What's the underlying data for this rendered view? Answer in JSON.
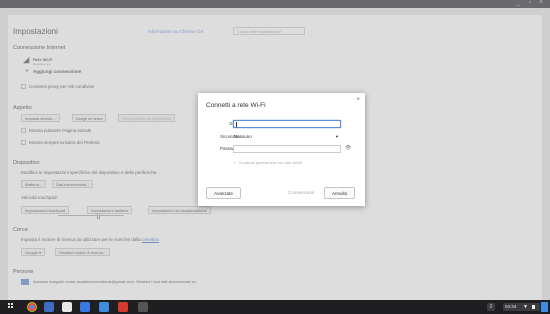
{
  "header": {
    "title": "Impostazioni",
    "about_link": "Informazioni su Chrome OS",
    "search_placeholder": "Cerca nelle impostazioni"
  },
  "internet": {
    "section": "Connessione Internet",
    "network_name": "Rete Wi-Fi",
    "network_status": "Nessuna rete",
    "add_connection": "Aggiungi connessione",
    "proxy_label": "Consenti proxy per reti condivise"
  },
  "appearance": {
    "section": "Aspetto",
    "wallpaper_button": "Imposta sfondo...",
    "theme_button": "Scegli un tema",
    "reset_theme_button": "Reimposta tema predefinito",
    "home_button_label": "Mostra pulsante Pagina iniziale",
    "bookmarks_bar_label": "Mostra sempre la barra dei Preferiti"
  },
  "device": {
    "section": "Dispositivo",
    "description": "Modifica le impostazioni specifiche del dispositivo e delle periferiche.",
    "battery_button": "Batteria...",
    "storage_button": "Dati memorizzati...",
    "touchpad_speed_label": "Velocità touchpad:",
    "touchpad_speed_fraction": 0.6,
    "touchpad_settings_button": "Impostazioni touchpad",
    "keyboard_settings_button": "Impostazioni tastiera",
    "display_settings_button": "Impostazioni di visualizzazione"
  },
  "search": {
    "section": "Cerca",
    "description": "Imposta il motore di ricerca da utilizzare per le ricerche dalla",
    "omnibox_link": "omnibox",
    "engine_select": "Google",
    "manage_engines_button": "Gestisci motori di ricerca..."
  },
  "people": {
    "section": "Persone",
    "signed_in": "Accesso eseguito come asuaduchromebook@gmail.com. Gestisci i tuoi dati sincronizzati su"
  },
  "dialog": {
    "title": "Connetti a rete Wi-Fi",
    "close": "×",
    "ssid_label": "SSID:",
    "ssid_value": "",
    "security_label": "Sicurezza:",
    "security_value": "Nessuno",
    "password_label": "Password:",
    "password_value": "",
    "share_label": "Condividi questa rete con altri utenti",
    "advanced_button": "Avanzate",
    "connect_button": "Connessione",
    "cancel_button": "Annulla"
  },
  "shelf": {
    "notifications": "0",
    "time": "04:34"
  },
  "colors": {
    "accent": "#3d8ce0",
    "link": "#3a6fd1",
    "shelf": "#1f1f22"
  }
}
